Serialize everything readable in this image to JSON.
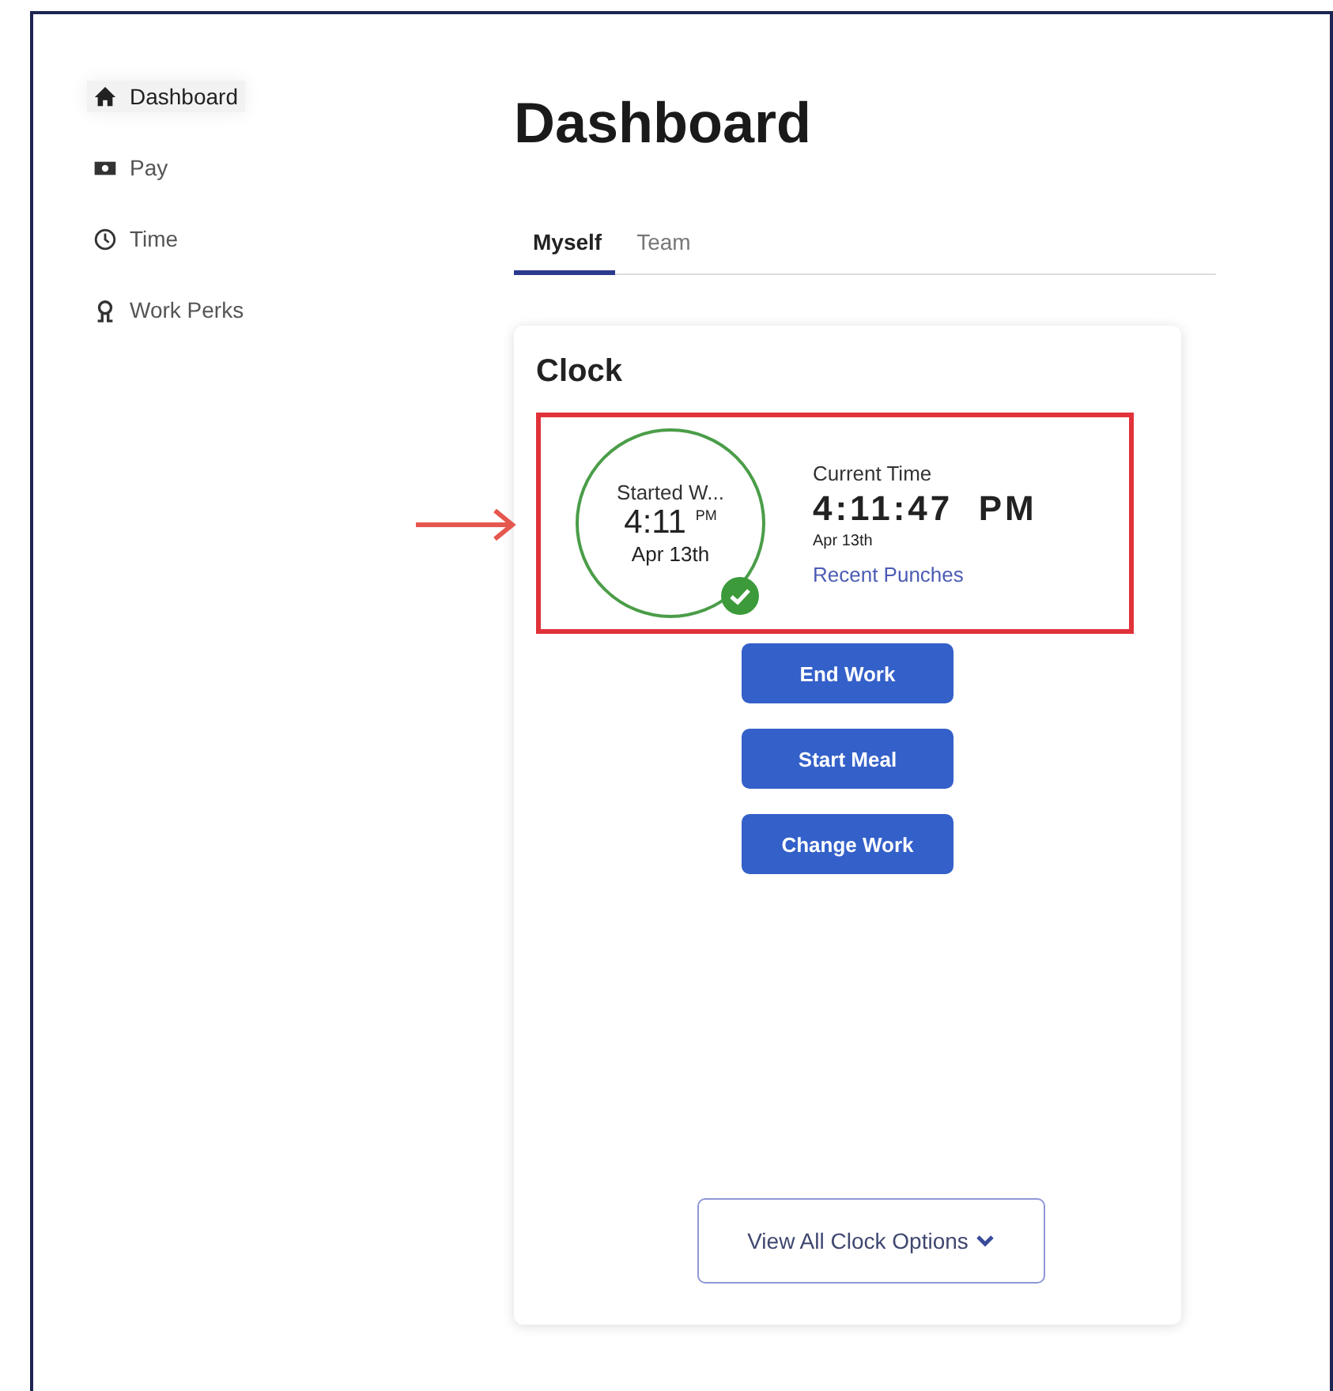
{
  "sidebar": {
    "items": [
      {
        "label": "Dashboard",
        "selected": true
      },
      {
        "label": "Pay",
        "selected": false
      },
      {
        "label": "Time",
        "selected": false
      },
      {
        "label": "Work Perks",
        "selected": false
      }
    ]
  },
  "page_title": "Dashboard",
  "tabs": [
    {
      "label": "Myself",
      "selected": true
    },
    {
      "label": "Team",
      "selected": false
    }
  ],
  "clock": {
    "title": "Clock",
    "highlighted": true,
    "started": {
      "label": "Started W...",
      "time": "4:11",
      "meridiem": "PM",
      "date": "Apr 13th",
      "confirmed": true
    },
    "current": {
      "label": "Current Time",
      "time": "4:11:47  PM",
      "date": "Apr 13th",
      "link": "Recent Punches"
    },
    "buttons": [
      "End Work",
      "Start Meal",
      "Change Work"
    ],
    "more_button": "View All Clock Options"
  }
}
